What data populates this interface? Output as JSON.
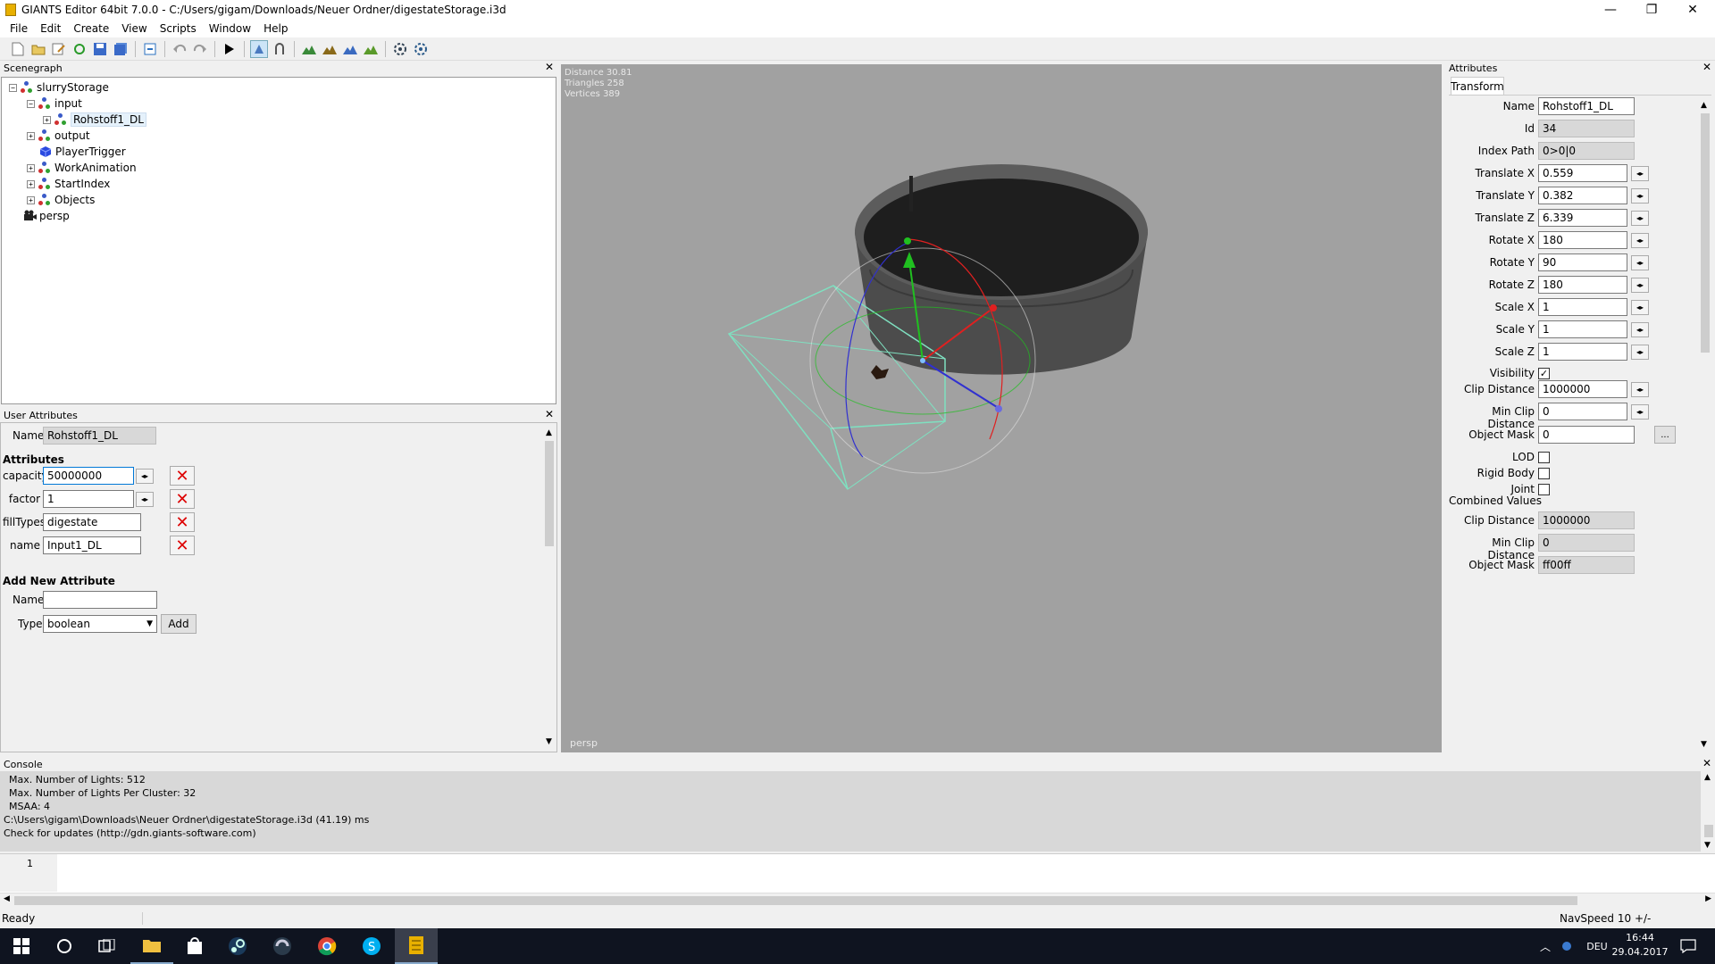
{
  "window": {
    "title": "GIANTS Editor 64bit 7.0.0 - C:/Users/gigam/Downloads/Neuer Ordner/digestateStorage.i3d",
    "controls": {
      "minimize": "—",
      "maximize": "❐",
      "close": "✕"
    }
  },
  "menu": [
    "File",
    "Edit",
    "Create",
    "View",
    "Scripts",
    "Window",
    "Help"
  ],
  "scenegraph": {
    "header": "Scenegraph",
    "nodes": [
      {
        "label": "slurryStorage",
        "toggle": "−"
      },
      {
        "label": "input",
        "toggle": "−"
      },
      {
        "label": "Rohstoff1_DL",
        "toggle": "+"
      },
      {
        "label": "output",
        "toggle": "+"
      },
      {
        "label": "PlayerTrigger",
        "toggle": ""
      },
      {
        "label": "WorkAnimation",
        "toggle": "+"
      },
      {
        "label": "StartIndex",
        "toggle": "+"
      },
      {
        "label": "Objects",
        "toggle": "+"
      },
      {
        "label": "persp",
        "toggle": ""
      }
    ]
  },
  "user_attributes": {
    "header": "User Attributes",
    "name_label": "Name",
    "name_value": "Rohstoff1_DL",
    "section": "Attributes",
    "rows": [
      {
        "label": "capacity",
        "value": "50000000"
      },
      {
        "label": "factor",
        "value": "1"
      },
      {
        "label": "fillTypes",
        "value": "digestate"
      },
      {
        "label": "name",
        "value": "Input1_DL"
      }
    ],
    "add_section": "Add New Attribute",
    "add_name_label": "Name",
    "add_name_value": "",
    "add_type_label": "Type",
    "add_type_value": "boolean",
    "add_button": "Add"
  },
  "viewport": {
    "stats": [
      "Distance 30.81",
      "Triangles 258",
      "Vertices 389"
    ],
    "camera": "persp"
  },
  "attributes": {
    "header": "Attributes",
    "tab": "Transform",
    "fields": [
      {
        "label": "Name",
        "value": "Rohstoff1_DL"
      },
      {
        "label": "Id",
        "value": "34"
      },
      {
        "label": "Index Path",
        "value": "0>0|0"
      },
      {
        "label": "Translate X",
        "value": "0.559"
      },
      {
        "label": "Translate Y",
        "value": "0.382"
      },
      {
        "label": "Translate Z",
        "value": "6.339"
      },
      {
        "label": "Rotate X",
        "value": "180"
      },
      {
        "label": "Rotate Y",
        "value": "90"
      },
      {
        "label": "Rotate Z",
        "value": "180"
      },
      {
        "label": "Scale X",
        "value": "1"
      },
      {
        "label": "Scale Y",
        "value": "1"
      },
      {
        "label": "Scale Z",
        "value": "1"
      },
      {
        "label": "Visibility",
        "value": true
      },
      {
        "label": "Clip Distance",
        "value": "1000000"
      },
      {
        "label": "Min Clip Distance",
        "value": "0"
      },
      {
        "label": "Object Mask",
        "value": "0"
      },
      {
        "label": "LOD",
        "value": false
      },
      {
        "label": "Rigid Body",
        "value": false
      },
      {
        "label": "Joint",
        "value": false
      }
    ],
    "combined_header": "Combined Values",
    "combined": [
      {
        "label": "Clip Distance",
        "value": "1000000"
      },
      {
        "label": "Min Clip Distance",
        "value": "0"
      },
      {
        "label": "Object Mask",
        "value": "ff00ff"
      }
    ],
    "ellipsis": "..."
  },
  "console": {
    "header": "Console",
    "lines": [
      "Max. Number of Lights: 512",
      "Max. Number of Lights Per Cluster: 32",
      "MSAA: 4",
      "C:\\Users\\gigam\\Downloads\\Neuer Ordner\\digestateStorage.i3d (41.19) ms",
      "Check for updates (http://gdn.giants-software.com)"
    ],
    "input_line_number": "1"
  },
  "status": {
    "left": "Ready",
    "right": "NavSpeed 10 +/-"
  },
  "taskbar": {
    "lang": "DEU",
    "time": "16:44",
    "date": "29.04.2017"
  },
  "colors": {
    "viewport_bg": "#a1a1a1",
    "selection_cyan": "#7fe0c0",
    "gizmo_red": "#e02020",
    "gizmo_green": "#20c020",
    "gizmo_blue": "#3030d0"
  }
}
